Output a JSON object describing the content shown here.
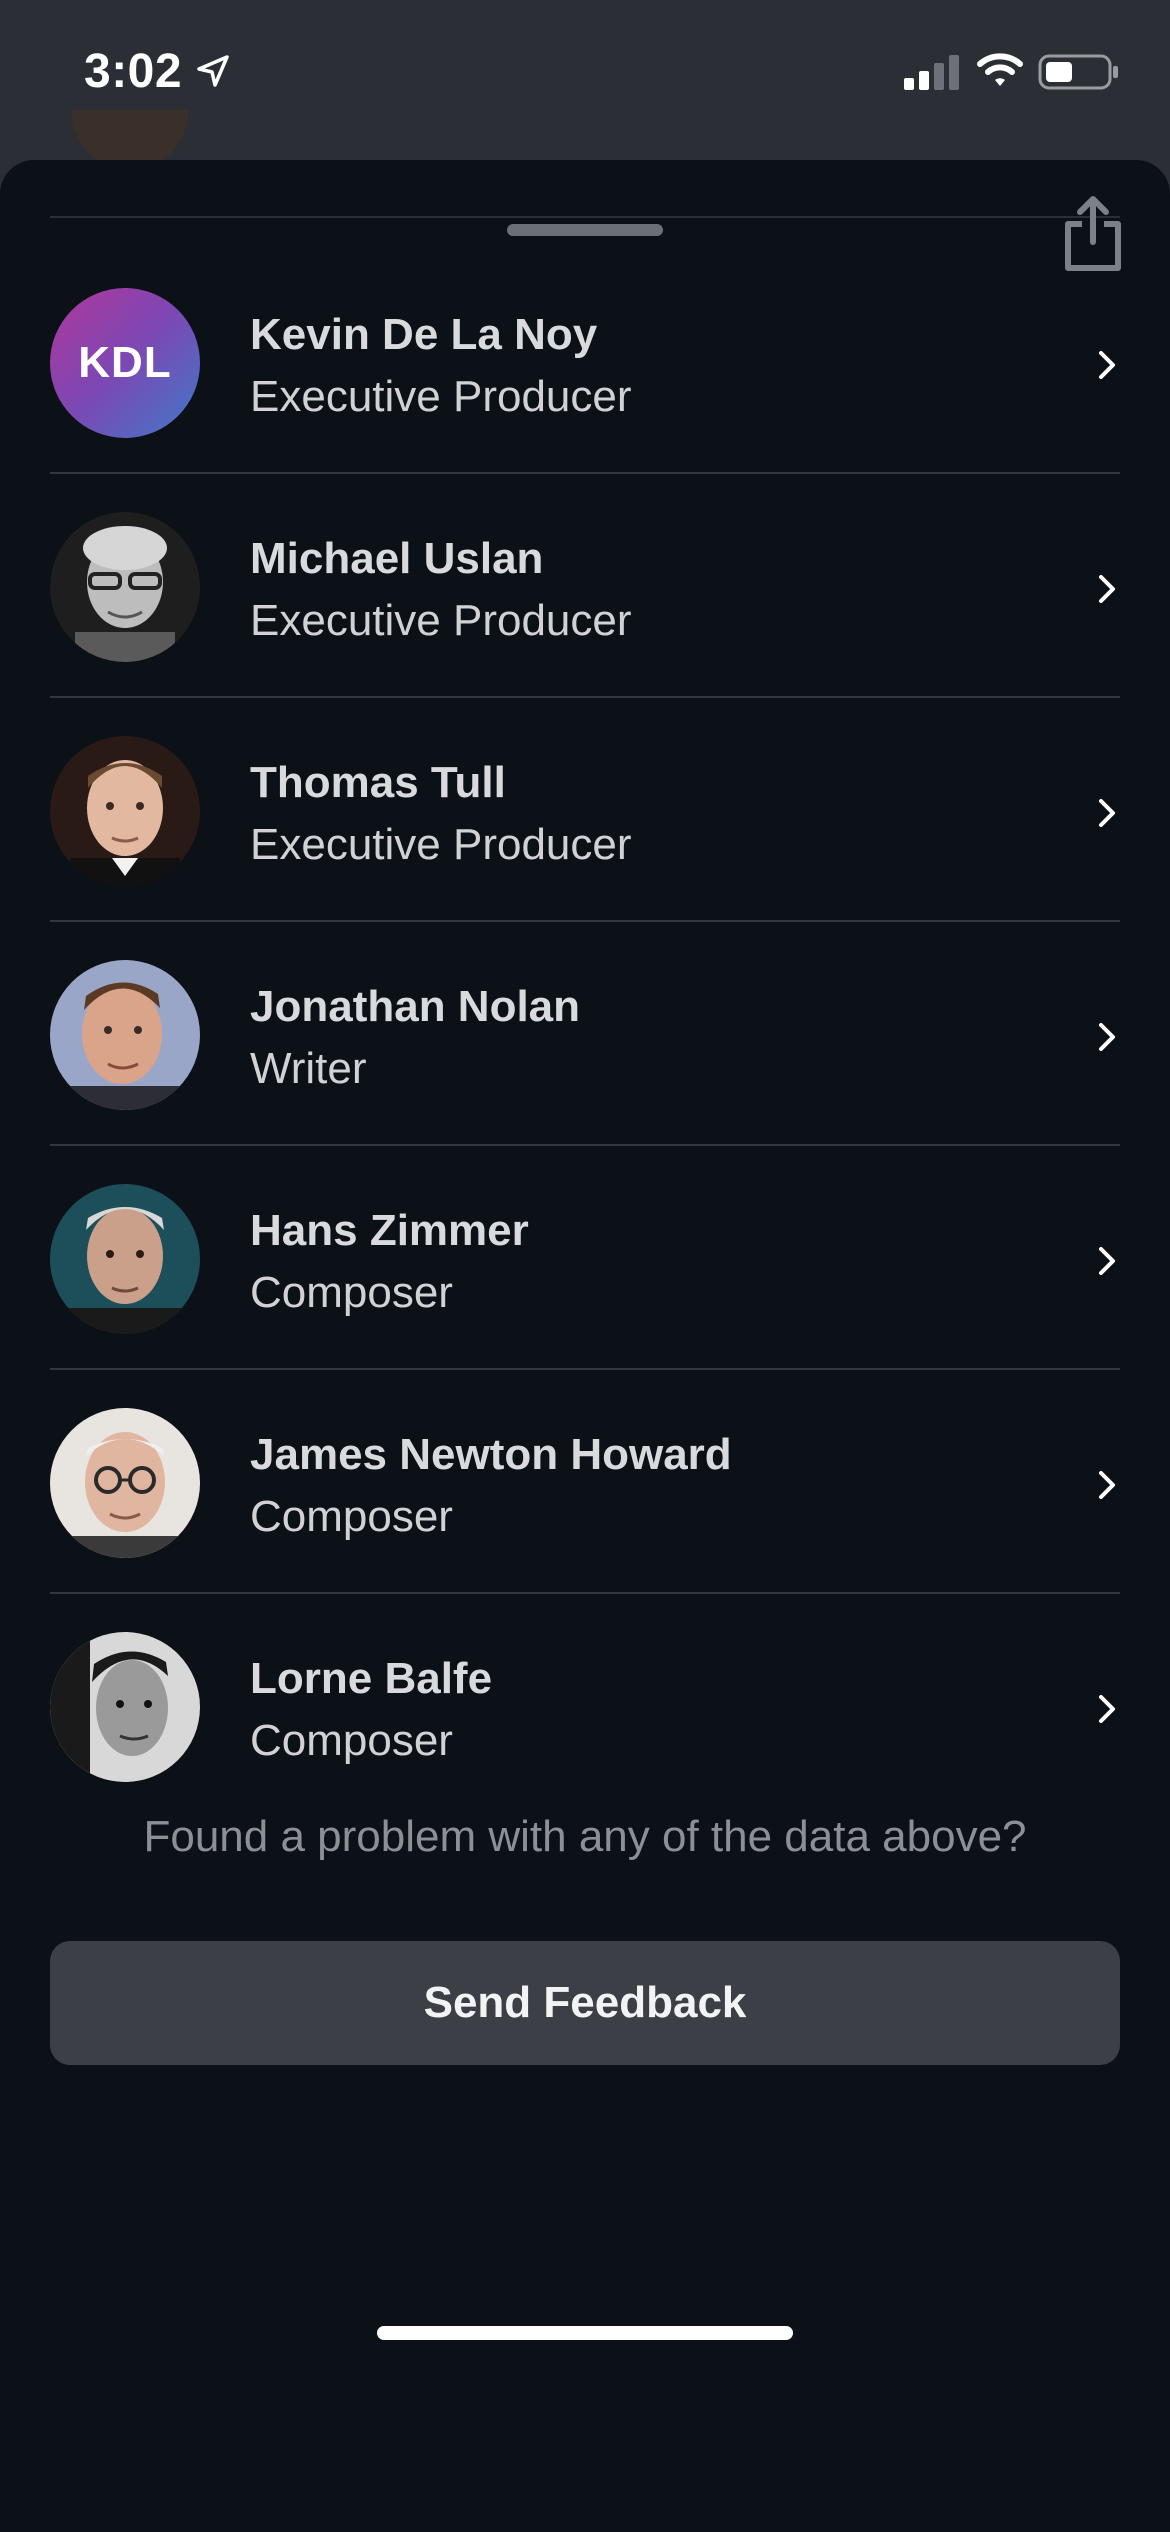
{
  "status_bar": {
    "time": "3:02",
    "icons": [
      "location-arrow-icon",
      "cellular-signal-icon",
      "wifi-icon",
      "battery-icon"
    ]
  },
  "sheet": {
    "share_icon": "share-icon"
  },
  "credits": [
    {
      "name": "Kevin De La Noy",
      "role": "Executive Producer",
      "avatar_type": "initials",
      "initials": "KDL"
    },
    {
      "name": "Michael Uslan",
      "role": "Executive Producer",
      "avatar_type": "photo"
    },
    {
      "name": "Thomas Tull",
      "role": "Executive Producer",
      "avatar_type": "photo"
    },
    {
      "name": "Jonathan Nolan",
      "role": "Writer",
      "avatar_type": "photo"
    },
    {
      "name": "Hans Zimmer",
      "role": "Composer",
      "avatar_type": "photo"
    },
    {
      "name": "James Newton Howard",
      "role": "Composer",
      "avatar_type": "photo"
    },
    {
      "name": "Lorne Balfe",
      "role": "Composer",
      "avatar_type": "photo"
    }
  ],
  "feedback": {
    "prompt": "Found a problem with any of the data above?",
    "button_label": "Send Feedback"
  },
  "colors": {
    "background": "#0c1117",
    "status_bar_bg": "#2b2e35",
    "button_bg": "#3c3f45",
    "text_primary": "#d8dadd",
    "text_muted": "#8c9096"
  }
}
